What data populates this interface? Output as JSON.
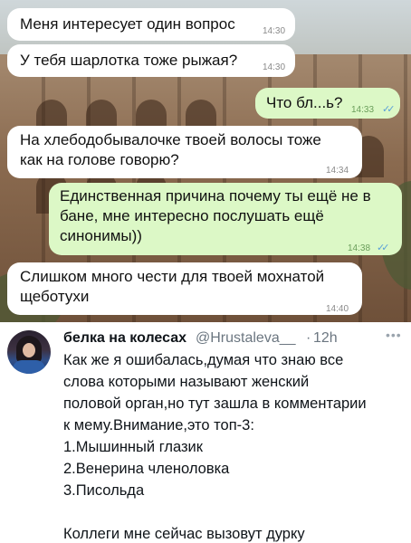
{
  "chat": {
    "messages": [
      {
        "text": "Меня интересует один вопрос",
        "time": "14:30",
        "direction": "in"
      },
      {
        "text": "У тебя шарлотка тоже рыжая?",
        "time": "14:30",
        "direction": "in"
      },
      {
        "text": "Что бл...ь?",
        "time": "14:33",
        "direction": "out"
      },
      {
        "lines": [
          "На хлебодобывалочке твоей волосы тоже",
          "как на голове говорю?"
        ],
        "time": "14:34",
        "direction": "in"
      },
      {
        "lines": [
          "Единственная причина почему ты ещё не в",
          "бане, мне интересно послушать ещё",
          "синонимы))"
        ],
        "time": "14:38",
        "direction": "out"
      },
      {
        "lines": [
          "Слишком много чести для твоей мохнатой",
          "щеботухи"
        ],
        "time": "14:40",
        "direction": "in"
      }
    ],
    "read_check": "✓✓",
    "colors": {
      "incoming": "#ffffff",
      "outgoing": "#dcf8c6"
    }
  },
  "tweet": {
    "name": "белка на колесах",
    "handle": "@Hrustaleva__",
    "separator": "·",
    "time": "12h",
    "more": "•••",
    "lines": [
      "Как же я ошибалась,думая что знаю все",
      "слова которыми называют женский",
      "половой орган,но тут зашла в комментарии",
      "к мему.Внимание,это топ-3:",
      "1.Мышинный глазик",
      "2.Венерина членоловка",
      "3.Писольда",
      "",
      "Коллеги мне сейчас вызовут дурку"
    ]
  }
}
